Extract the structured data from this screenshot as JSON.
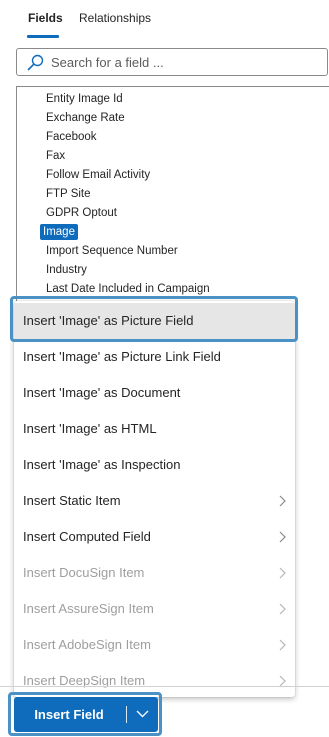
{
  "tabs": {
    "fields": "Fields",
    "relationships": "Relationships"
  },
  "search": {
    "placeholder": "Search for a field ..."
  },
  "fields": [
    "Entity Image Id",
    "Exchange Rate",
    "Facebook",
    "Fax",
    "Follow Email Activity",
    "FTP Site",
    "GDPR Optout",
    "Image",
    "Import Sequence Number",
    "Industry",
    "Last Date Included in Campaign"
  ],
  "selected_field": "Image",
  "menu": {
    "items": [
      {
        "label": "Insert 'Image' as Picture Field",
        "disabled": false,
        "submenu": false,
        "highlighted": true
      },
      {
        "label": "Insert 'Image' as Picture Link Field",
        "disabled": false,
        "submenu": false
      },
      {
        "label": "Insert 'Image' as Document",
        "disabled": false,
        "submenu": false
      },
      {
        "label": "Insert 'Image' as HTML",
        "disabled": false,
        "submenu": false
      },
      {
        "label": "Insert 'Image' as Inspection",
        "disabled": false,
        "submenu": false
      },
      {
        "label": "Insert Static Item",
        "disabled": false,
        "submenu": true
      },
      {
        "label": "Insert Computed Field",
        "disabled": false,
        "submenu": true
      },
      {
        "label": "Insert DocuSign Item",
        "disabled": true,
        "submenu": true
      },
      {
        "label": "Insert AssureSign Item",
        "disabled": true,
        "submenu": true
      },
      {
        "label": "Insert AdobeSign Item",
        "disabled": true,
        "submenu": true
      },
      {
        "label": "Insert DeepSign Item",
        "disabled": true,
        "submenu": true
      }
    ]
  },
  "insert_button": {
    "label": "Insert Field"
  },
  "colors": {
    "accent": "#0f6cbd",
    "highlight_frame": "#4a92c5",
    "disabled_text": "#9e9e9e"
  }
}
